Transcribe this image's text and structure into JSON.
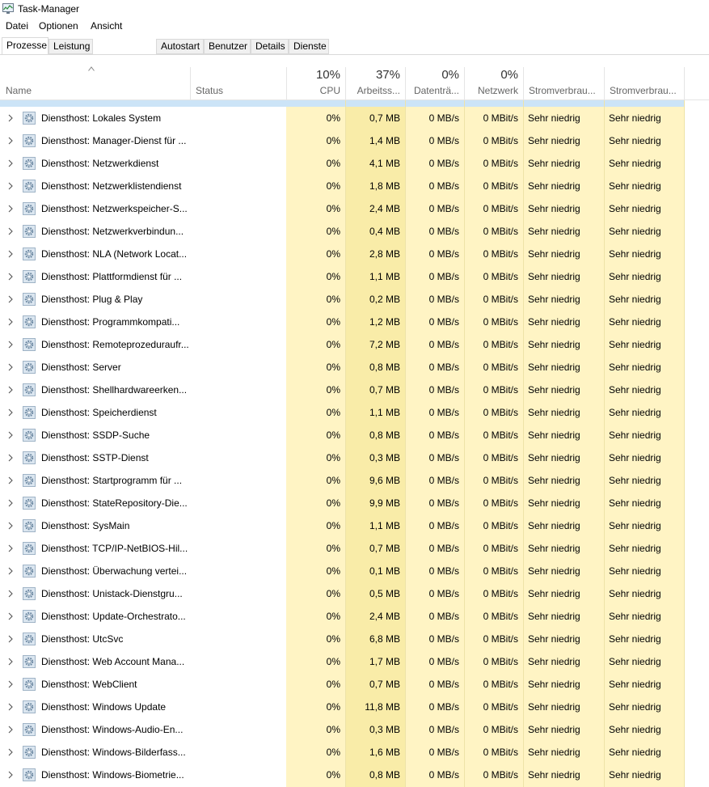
{
  "window": {
    "title": "Task-Manager"
  },
  "menu": [
    "Datei",
    "Optionen",
    "Ansicht"
  ],
  "tabs": [
    "Prozesse",
    "Leistung",
    "Autostart",
    "Benutzer",
    "Details",
    "Dienste"
  ],
  "columns": {
    "name": "Name",
    "status": "Status",
    "cpu": {
      "pct": "10%",
      "label": "CPU"
    },
    "memory": {
      "pct": "37%",
      "label": "Arbeitss..."
    },
    "disk": {
      "pct": "0%",
      "label": "Datenträ..."
    },
    "network": {
      "pct": "0%",
      "label": "Netzwerk"
    },
    "power": {
      "label": "Stromverbrau..."
    },
    "power_trend": {
      "label": "Stromverbrau..."
    }
  },
  "icons": {
    "row_icon": "gear-icon",
    "expand": "chevron-right-icon",
    "app": "task-manager-icon"
  },
  "rows": [
    {
      "name": "Diensthost: Lokales System",
      "cpu": "0%",
      "mem": "0,7 MB",
      "disk": "0 MB/s",
      "net": "0 MBit/s",
      "power": "Sehr niedrig",
      "trend": "Sehr niedrig"
    },
    {
      "name": "Diensthost: Manager-Dienst für ...",
      "cpu": "0%",
      "mem": "1,4 MB",
      "disk": "0 MB/s",
      "net": "0 MBit/s",
      "power": "Sehr niedrig",
      "trend": "Sehr niedrig"
    },
    {
      "name": "Diensthost: Netzwerkdienst",
      "cpu": "0%",
      "mem": "4,1 MB",
      "disk": "0 MB/s",
      "net": "0 MBit/s",
      "power": "Sehr niedrig",
      "trend": "Sehr niedrig"
    },
    {
      "name": "Diensthost: Netzwerklistendienst",
      "cpu": "0%",
      "mem": "1,8 MB",
      "disk": "0 MB/s",
      "net": "0 MBit/s",
      "power": "Sehr niedrig",
      "trend": "Sehr niedrig"
    },
    {
      "name": "Diensthost: Netzwerkspeicher-S...",
      "cpu": "0%",
      "mem": "2,4 MB",
      "disk": "0 MB/s",
      "net": "0 MBit/s",
      "power": "Sehr niedrig",
      "trend": "Sehr niedrig"
    },
    {
      "name": "Diensthost: Netzwerkverbindun...",
      "cpu": "0%",
      "mem": "0,4 MB",
      "disk": "0 MB/s",
      "net": "0 MBit/s",
      "power": "Sehr niedrig",
      "trend": "Sehr niedrig"
    },
    {
      "name": "Diensthost: NLA (Network Locat...",
      "cpu": "0%",
      "mem": "2,8 MB",
      "disk": "0 MB/s",
      "net": "0 MBit/s",
      "power": "Sehr niedrig",
      "trend": "Sehr niedrig"
    },
    {
      "name": "Diensthost: Plattformdienst für ...",
      "cpu": "0%",
      "mem": "1,1 MB",
      "disk": "0 MB/s",
      "net": "0 MBit/s",
      "power": "Sehr niedrig",
      "trend": "Sehr niedrig"
    },
    {
      "name": "Diensthost: Plug & Play",
      "cpu": "0%",
      "mem": "0,2 MB",
      "disk": "0 MB/s",
      "net": "0 MBit/s",
      "power": "Sehr niedrig",
      "trend": "Sehr niedrig"
    },
    {
      "name": "Diensthost: Programmkompati...",
      "cpu": "0%",
      "mem": "1,2 MB",
      "disk": "0 MB/s",
      "net": "0 MBit/s",
      "power": "Sehr niedrig",
      "trend": "Sehr niedrig"
    },
    {
      "name": "Diensthost: Remoteprozeduraufr...",
      "cpu": "0%",
      "mem": "7,2 MB",
      "disk": "0 MB/s",
      "net": "0 MBit/s",
      "power": "Sehr niedrig",
      "trend": "Sehr niedrig"
    },
    {
      "name": "Diensthost: Server",
      "cpu": "0%",
      "mem": "0,8 MB",
      "disk": "0 MB/s",
      "net": "0 MBit/s",
      "power": "Sehr niedrig",
      "trend": "Sehr niedrig"
    },
    {
      "name": "Diensthost: Shellhardwareerken...",
      "cpu": "0%",
      "mem": "0,7 MB",
      "disk": "0 MB/s",
      "net": "0 MBit/s",
      "power": "Sehr niedrig",
      "trend": "Sehr niedrig"
    },
    {
      "name": "Diensthost: Speicherdienst",
      "cpu": "0%",
      "mem": "1,1 MB",
      "disk": "0 MB/s",
      "net": "0 MBit/s",
      "power": "Sehr niedrig",
      "trend": "Sehr niedrig"
    },
    {
      "name": "Diensthost: SSDP-Suche",
      "cpu": "0%",
      "mem": "0,8 MB",
      "disk": "0 MB/s",
      "net": "0 MBit/s",
      "power": "Sehr niedrig",
      "trend": "Sehr niedrig"
    },
    {
      "name": "Diensthost: SSTP-Dienst",
      "cpu": "0%",
      "mem": "0,3 MB",
      "disk": "0 MB/s",
      "net": "0 MBit/s",
      "power": "Sehr niedrig",
      "trend": "Sehr niedrig"
    },
    {
      "name": "Diensthost: Startprogramm für ...",
      "cpu": "0%",
      "mem": "9,6 MB",
      "disk": "0 MB/s",
      "net": "0 MBit/s",
      "power": "Sehr niedrig",
      "trend": "Sehr niedrig"
    },
    {
      "name": "Diensthost: StateRepository-Die...",
      "cpu": "0%",
      "mem": "9,9 MB",
      "disk": "0 MB/s",
      "net": "0 MBit/s",
      "power": "Sehr niedrig",
      "trend": "Sehr niedrig"
    },
    {
      "name": "Diensthost: SysMain",
      "cpu": "0%",
      "mem": "1,1 MB",
      "disk": "0 MB/s",
      "net": "0 MBit/s",
      "power": "Sehr niedrig",
      "trend": "Sehr niedrig"
    },
    {
      "name": "Diensthost: TCP/IP-NetBIOS-Hil...",
      "cpu": "0%",
      "mem": "0,7 MB",
      "disk": "0 MB/s",
      "net": "0 MBit/s",
      "power": "Sehr niedrig",
      "trend": "Sehr niedrig"
    },
    {
      "name": "Diensthost: Überwachung vertei...",
      "cpu": "0%",
      "mem": "0,1 MB",
      "disk": "0 MB/s",
      "net": "0 MBit/s",
      "power": "Sehr niedrig",
      "trend": "Sehr niedrig"
    },
    {
      "name": "Diensthost: Unistack-Dienstgru...",
      "cpu": "0%",
      "mem": "0,5 MB",
      "disk": "0 MB/s",
      "net": "0 MBit/s",
      "power": "Sehr niedrig",
      "trend": "Sehr niedrig"
    },
    {
      "name": "Diensthost: Update-Orchestrato...",
      "cpu": "0%",
      "mem": "2,4 MB",
      "disk": "0 MB/s",
      "net": "0 MBit/s",
      "power": "Sehr niedrig",
      "trend": "Sehr niedrig"
    },
    {
      "name": "Diensthost: UtcSvc",
      "cpu": "0%",
      "mem": "6,8 MB",
      "disk": "0 MB/s",
      "net": "0 MBit/s",
      "power": "Sehr niedrig",
      "trend": "Sehr niedrig"
    },
    {
      "name": "Diensthost: Web Account Mana...",
      "cpu": "0%",
      "mem": "1,7 MB",
      "disk": "0 MB/s",
      "net": "0 MBit/s",
      "power": "Sehr niedrig",
      "trend": "Sehr niedrig"
    },
    {
      "name": "Diensthost: WebClient",
      "cpu": "0%",
      "mem": "0,7 MB",
      "disk": "0 MB/s",
      "net": "0 MBit/s",
      "power": "Sehr niedrig",
      "trend": "Sehr niedrig"
    },
    {
      "name": "Diensthost: Windows Update",
      "cpu": "0%",
      "mem": "11,8 MB",
      "disk": "0 MB/s",
      "net": "0 MBit/s",
      "power": "Sehr niedrig",
      "trend": "Sehr niedrig"
    },
    {
      "name": "Diensthost: Windows-Audio-En...",
      "cpu": "0%",
      "mem": "0,3 MB",
      "disk": "0 MB/s",
      "net": "0 MBit/s",
      "power": "Sehr niedrig",
      "trend": "Sehr niedrig"
    },
    {
      "name": "Diensthost: Windows-Bilderfass...",
      "cpu": "0%",
      "mem": "1,6 MB",
      "disk": "0 MB/s",
      "net": "0 MBit/s",
      "power": "Sehr niedrig",
      "trend": "Sehr niedrig"
    },
    {
      "name": "Diensthost: Windows-Biometrie...",
      "cpu": "0%",
      "mem": "0,8 MB",
      "disk": "0 MB/s",
      "net": "0 MBit/s",
      "power": "Sehr niedrig",
      "trend": "Sehr niedrig"
    }
  ]
}
